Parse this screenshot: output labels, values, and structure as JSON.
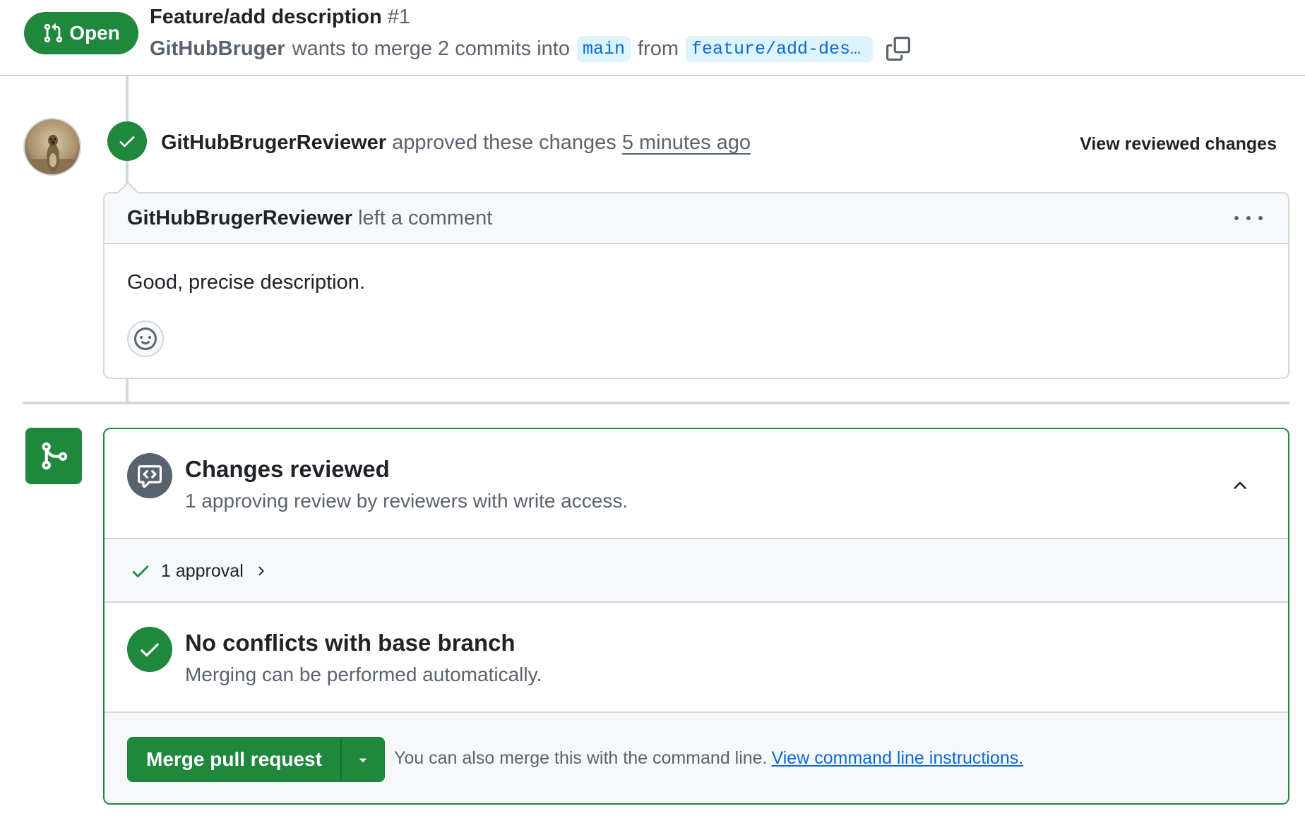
{
  "header": {
    "state_label": "Open",
    "title": "Feature/add description",
    "number": "#1",
    "author": "GitHubBruger",
    "merge_text": "wants to merge 2 commits into",
    "base_branch": "main",
    "from_text": "from",
    "head_branch": "feature/add-description"
  },
  "review": {
    "author": "GitHubBrugerReviewer",
    "action_text": "approved these changes",
    "time": "5 minutes ago",
    "view_changes_label": "View reviewed changes"
  },
  "comment": {
    "author": "GitHubBrugerReviewer",
    "action_text": "left a comment",
    "body": "Good, precise description."
  },
  "merge_box": {
    "reviewed_title": "Changes reviewed",
    "reviewed_subtitle": "1 approving review by reviewers with write access.",
    "approvals_label": "1 approval",
    "conflicts_title": "No conflicts with base branch",
    "conflicts_subtitle": "Merging can be performed automatically.",
    "merge_button_label": "Merge pull request",
    "cli_text": "You can also merge this with the command line.",
    "cli_link": "View command line instructions."
  },
  "colors": {
    "success": "#1f883d",
    "muted": "#59636e",
    "accent": "#0969da",
    "border": "#d0d7de"
  }
}
